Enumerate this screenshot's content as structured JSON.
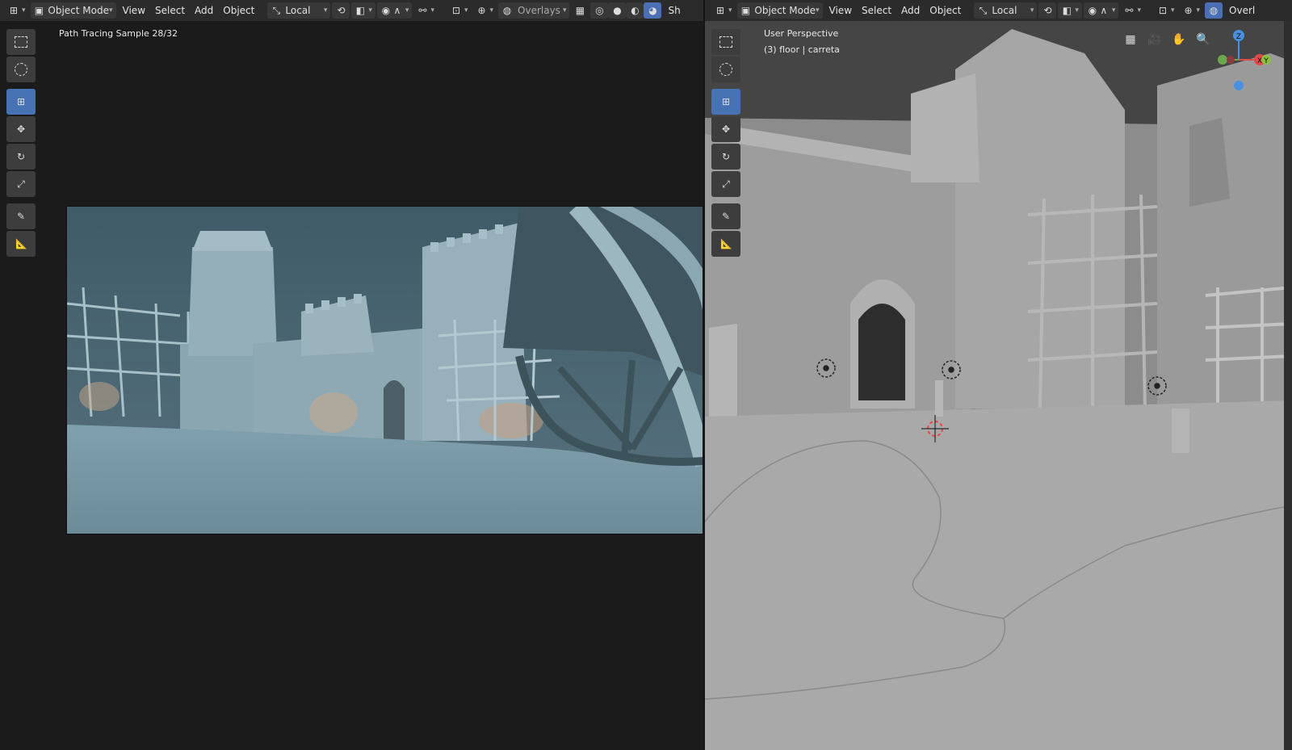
{
  "left_viewport": {
    "header": {
      "editor_type_icon": "viewport-icon",
      "mode": "Object Mode",
      "menus": [
        "View",
        "Select",
        "Add",
        "Object"
      ],
      "transform_orientation": "Local",
      "overlays_label": "Overlays",
      "shading_label": "Sh"
    },
    "info_text": "Path Tracing Sample 28/32",
    "tools": [
      "select-box-icon",
      "cursor-icon",
      "transform-icon",
      "move-icon",
      "rotate-icon",
      "scale-icon",
      "annotate-icon",
      "measure-icon"
    ],
    "active_tool": "transform-icon"
  },
  "right_viewport": {
    "header": {
      "editor_type_icon": "viewport-icon",
      "mode": "Object Mode",
      "menus": [
        "View",
        "Select",
        "Add",
        "Object"
      ],
      "transform_orientation": "Local",
      "overlays_label": "Overl"
    },
    "perspective_label": "User Perspective",
    "object_label": "(3) floor | carreta",
    "tools": [
      "select-box-icon",
      "cursor-icon",
      "transform-icon",
      "move-icon",
      "rotate-icon",
      "scale-icon",
      "annotate-icon",
      "measure-icon"
    ],
    "active_tool": "transform-icon",
    "gizmo": {
      "x": "X",
      "y": "Y",
      "z": "Z"
    }
  },
  "colors": {
    "header_bg": "#2b2b2b",
    "active_blue": "#4772b3",
    "render_tint": "#476572",
    "solid_gray": "#a8a8a8"
  }
}
